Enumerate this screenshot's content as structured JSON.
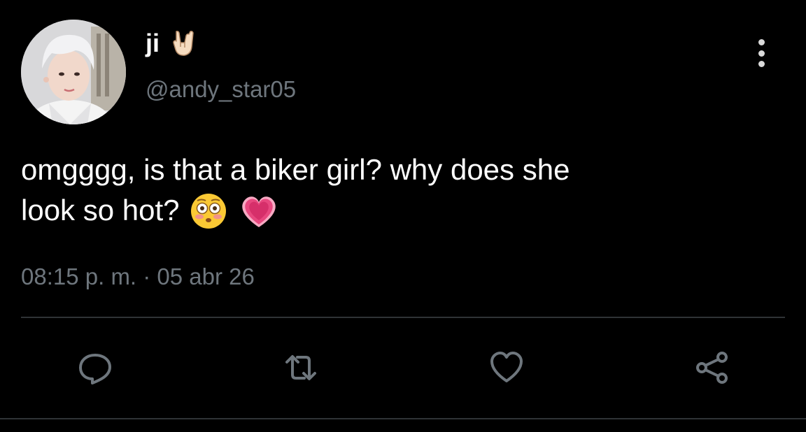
{
  "author": {
    "display_name": "ji",
    "name_emoji": "sign-of-the-horns-emoji",
    "handle": "@andy_star05",
    "avatar": "profile-photo"
  },
  "tweet": {
    "line1": "omgggg, is that a biker girl? why does she",
    "line2": "look so hot?",
    "emojis": [
      "flushed-face-emoji",
      "growing-heart-emoji"
    ],
    "timestamp": "08:15 p. m. · 05 abr 26"
  },
  "actions": [
    "reply-icon",
    "retweet-icon",
    "like-icon",
    "share-icon"
  ],
  "colors": {
    "background": "#000000",
    "text": "#ffffff",
    "secondary": "#6e767d",
    "divider": "#2f3336",
    "heart_emoji": "#e8477f"
  }
}
